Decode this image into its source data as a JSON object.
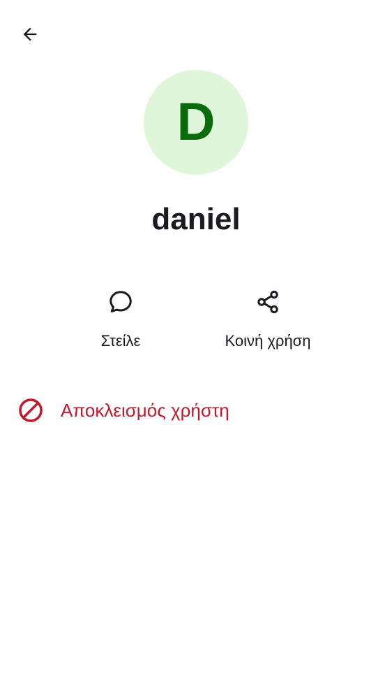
{
  "theme": {
    "avatar_bg": "#dff6da",
    "avatar_fg": "#0a6b0a",
    "danger": "#c4172c",
    "text": "#1b1b1f"
  },
  "header": {
    "back_icon": "arrow-left-icon"
  },
  "profile": {
    "avatar_letter": "D",
    "name": "daniel"
  },
  "actions": [
    {
      "icon": "chat-bubble-icon",
      "label": "Στείλε"
    },
    {
      "icon": "share-icon",
      "label": "Κοινή χρήση"
    }
  ],
  "block": {
    "icon": "block-icon",
    "label": "Αποκλεισμός χρήστη"
  }
}
